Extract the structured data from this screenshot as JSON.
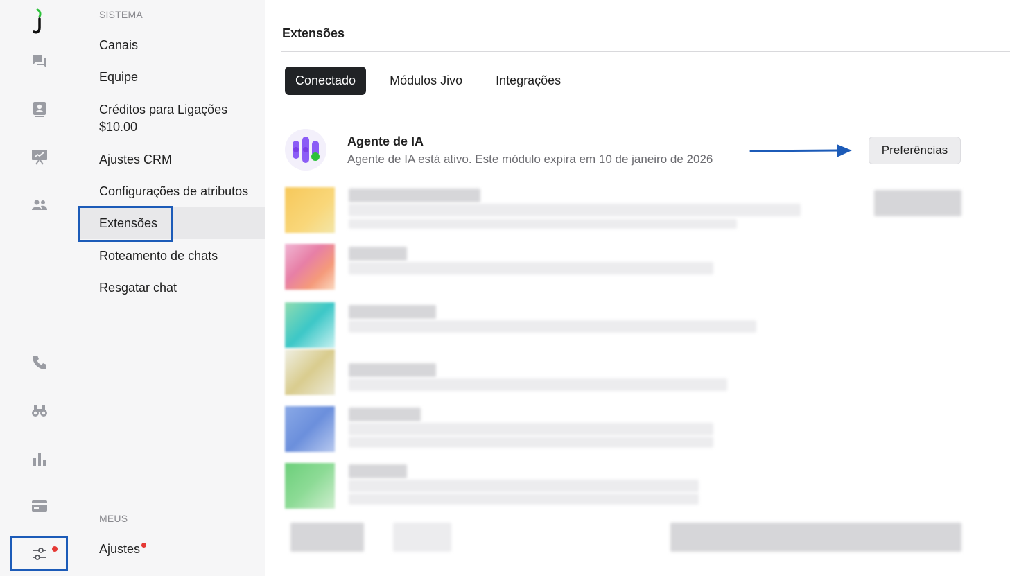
{
  "menu": {
    "section_system": "SISTEMA",
    "items": [
      {
        "label": "Canais"
      },
      {
        "label": "Equipe"
      },
      {
        "label": "Créditos para Ligações",
        "sub": "$10.00"
      },
      {
        "label": "Ajustes CRM"
      },
      {
        "label": "Configurações de atributos"
      },
      {
        "label": "Extensões"
      },
      {
        "label": "Roteamento de chats"
      },
      {
        "label": "Resgatar chat"
      }
    ],
    "section_mine": "MEUS",
    "ajustes": "Ajustes"
  },
  "main": {
    "title": "Extensões",
    "tabs": [
      {
        "label": "Conectado",
        "active": true
      },
      {
        "label": "Módulos Jivo",
        "active": false
      },
      {
        "label": "Integrações",
        "active": false
      }
    ],
    "extension": {
      "name": "Agente de IA",
      "description": "Agente de IA está ativo. Este módulo expira em 10 de janeiro de 2026",
      "button": "Preferências"
    }
  },
  "colors": {
    "accent_box": "#1c5bb8",
    "tab_active_bg": "#212326",
    "notification_dot": "#e53935",
    "logo_green": "#2cc23a"
  }
}
